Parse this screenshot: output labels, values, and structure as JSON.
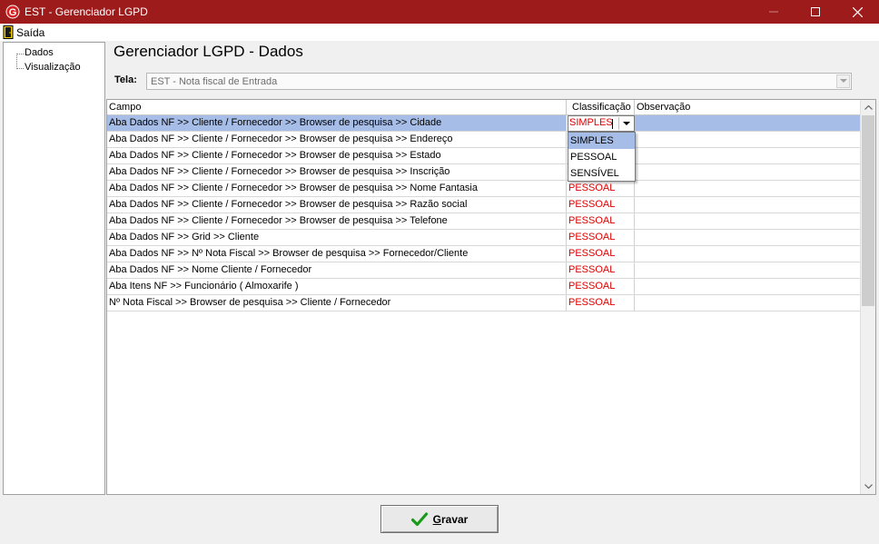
{
  "window": {
    "title": "EST - Gerenciador LGPD",
    "brand_color": "#9e1b1b"
  },
  "menu": {
    "exit_label": "Saída"
  },
  "tree": {
    "items": [
      "Dados",
      "Visualização"
    ]
  },
  "page": {
    "heading": "Gerenciador LGPD - Dados",
    "tela_label": "Tela:",
    "tela_value": "EST - Nota fiscal de Entrada"
  },
  "grid": {
    "columns": [
      "Campo",
      "Classificação",
      "Observação"
    ],
    "rows": [
      {
        "campo": "Aba Dados NF >> Cliente / Fornecedor >> Browser de pesquisa >> Cidade",
        "classificacao": "SIMPLES",
        "observacao": ""
      },
      {
        "campo": "Aba Dados NF >> Cliente / Fornecedor >> Browser de pesquisa >> Endereço",
        "classificacao": "",
        "observacao": ""
      },
      {
        "campo": "Aba Dados NF >> Cliente / Fornecedor >> Browser de pesquisa >> Estado",
        "classificacao": "",
        "observacao": ""
      },
      {
        "campo": "Aba Dados NF >> Cliente / Fornecedor >> Browser de pesquisa >> Inscrição",
        "classificacao": "",
        "observacao": ""
      },
      {
        "campo": "Aba Dados NF >> Cliente / Fornecedor >> Browser de pesquisa >> Nome Fantasia",
        "classificacao": "PESSOAL",
        "observacao": ""
      },
      {
        "campo": "Aba Dados NF >> Cliente / Fornecedor >> Browser de pesquisa >> Razão social",
        "classificacao": "PESSOAL",
        "observacao": ""
      },
      {
        "campo": "Aba Dados NF >> Cliente / Fornecedor >> Browser de pesquisa >> Telefone",
        "classificacao": "PESSOAL",
        "observacao": ""
      },
      {
        "campo": "Aba Dados NF >> Grid  >> Cliente",
        "classificacao": "PESSOAL",
        "observacao": ""
      },
      {
        "campo": "Aba Dados NF >> Nº Nota Fiscal >> Browser de pesquisa >> Fornecedor/Cliente",
        "classificacao": "PESSOAL",
        "observacao": ""
      },
      {
        "campo": "Aba Dados NF >> Nome Cliente / Fornecedor",
        "classificacao": "PESSOAL",
        "observacao": ""
      },
      {
        "campo": "Aba Itens NF >> Funcionário ( Almoxarife )",
        "classificacao": "PESSOAL",
        "observacao": ""
      },
      {
        "campo": "Nº Nota Fiscal >> Browser de pesquisa >> Cliente / Fornecedor",
        "classificacao": "PESSOAL",
        "observacao": ""
      }
    ],
    "editor_value": "SIMPLES",
    "dropdown_options": [
      "SIMPLES",
      "PESSOAL",
      "SENSÍVEL"
    ],
    "selection_color": "#a6bde8",
    "value_color": "#e00000"
  },
  "buttons": {
    "save_underlined": "G",
    "save_rest": "ravar"
  }
}
